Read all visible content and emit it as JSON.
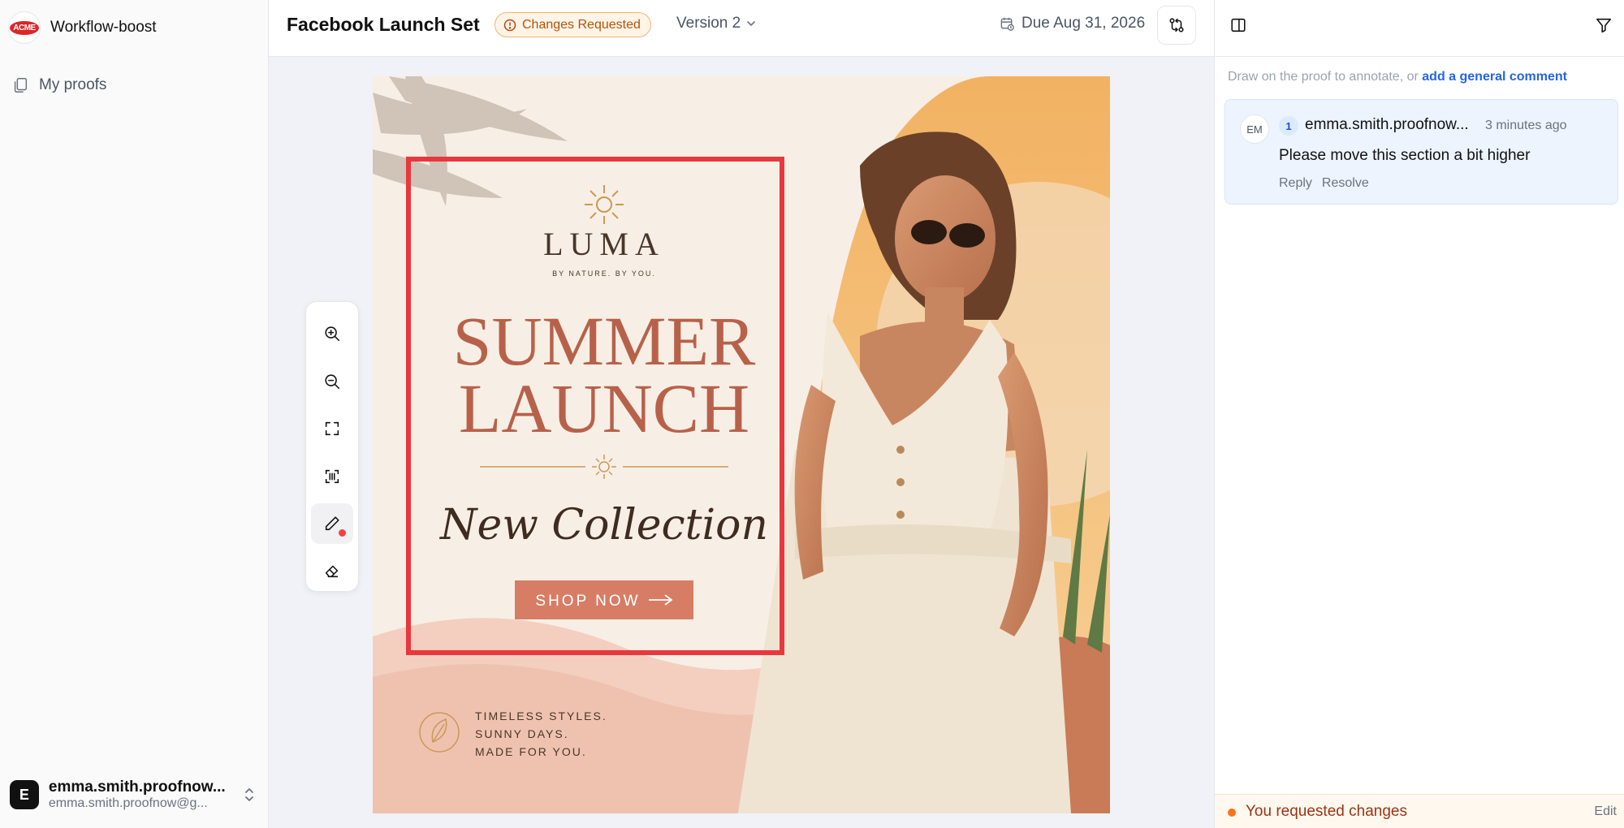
{
  "brand": {
    "logo_text": "ACME",
    "name": "Workflow-boost"
  },
  "sidebar": {
    "items": [
      {
        "label": "My proofs",
        "icon": "proofs-icon"
      }
    ]
  },
  "user": {
    "initial": "E",
    "name": "emma.smith.proofnow...",
    "email": "emma.smith.proofnow@g..."
  },
  "header": {
    "title": "Facebook Launch Set",
    "status": "Changes Requested",
    "version": "Version 2",
    "due": "Due Aug 31, 2026"
  },
  "proof": {
    "brand": "LUMA",
    "tagline": "BY NATURE. BY YOU.",
    "headline_1": "SUMMER",
    "headline_2": "LAUNCH",
    "script": "New Collection",
    "cta": "SHOP NOW",
    "footer_1": "TIMELESS STYLES.",
    "footer_2": "SUNNY DAYS.",
    "footer_3": "MADE FOR YOU."
  },
  "panel": {
    "hint_prefix": "Draw on the proof to annotate, or ",
    "hint_link": "add a general comment",
    "comments": [
      {
        "avatar": "EM",
        "number": "1",
        "author": "emma.smith.proofnow...",
        "time": "3 minutes ago",
        "text": "Please move this section a bit higher",
        "reply": "Reply",
        "resolve": "Resolve"
      }
    ],
    "footer_status": "You requested changes",
    "footer_edit": "Edit"
  },
  "colors": {
    "status_bg": "#fff4e6",
    "status_text": "#b45309",
    "annotation": "#e8383d",
    "link": "#2563eb",
    "headline": "#b8614a",
    "cta_bg": "#d77d65"
  }
}
